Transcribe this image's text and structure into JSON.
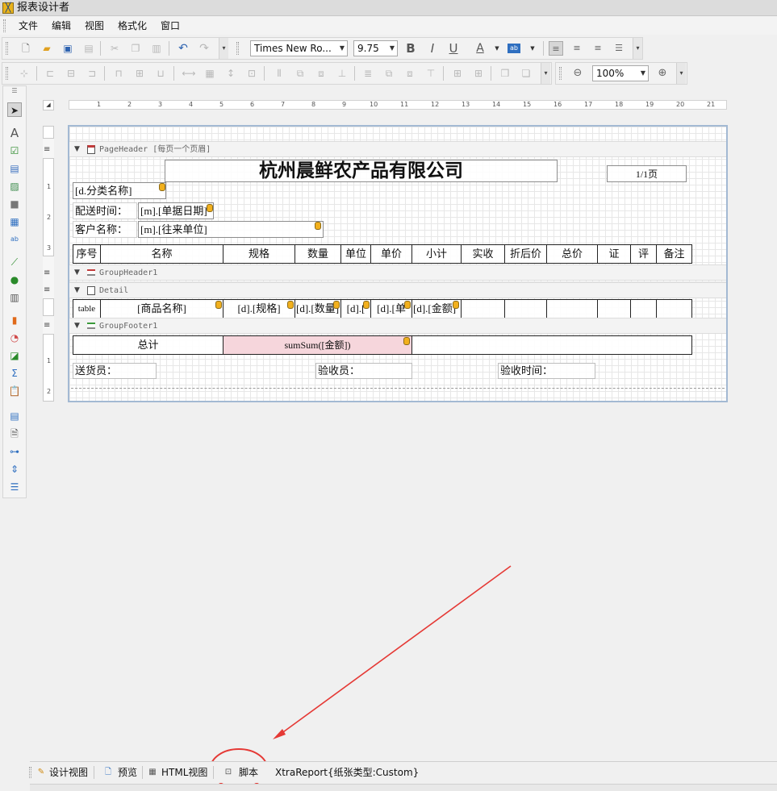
{
  "app": {
    "title": "报表设计者",
    "icon": "report-designer-icon"
  },
  "menu": [
    "文件",
    "编辑",
    "视图",
    "格式化",
    "窗口"
  ],
  "toolbar1": {
    "font_family": "Times New Ro...",
    "font_size": "9.75",
    "bold": "B",
    "italic": "I",
    "underline": "U",
    "font_color": "A",
    "highlight": "ab"
  },
  "toolbar2": {
    "zoom": "100%"
  },
  "ruler": [
    "1",
    "2",
    "3",
    "4",
    "5",
    "6",
    "7",
    "8",
    "9",
    "10",
    "11",
    "12",
    "13",
    "14",
    "15",
    "16",
    "17",
    "18",
    "19",
    "20",
    "21"
  ],
  "vruler": {
    "seg1": [
      "1",
      "2",
      "3"
    ],
    "seg2": [
      "1",
      "2"
    ]
  },
  "bands": {
    "page_header": "PageHeader [每页一个页眉]",
    "group_header": "GroupHeader1",
    "detail": "Detail",
    "group_footer": "GroupFooter1"
  },
  "report": {
    "title": "杭州晨鲜农产品有限公司",
    "page_no": "1/1页",
    "category": "[d.分类名称]",
    "delivery_label": "配送时间：",
    "delivery_value": "[m].[单据日期]",
    "customer_label": "客户名称：",
    "customer_value": "[m].[往来单位]"
  },
  "table_header": [
    "序号",
    "名称",
    "规格",
    "数量",
    "单位",
    "单价",
    "小计",
    "实收",
    "折后价",
    "总价",
    "证",
    "评",
    "备注"
  ],
  "detail_row": [
    "table",
    "[商品名称]",
    "[d].[规格]",
    "[d].[数量]",
    "[d].[",
    "[d].[单",
    "[d].[金额]",
    "",
    "",
    "",
    "",
    "",
    ""
  ],
  "footer": {
    "total_label": "总计",
    "total_value": "sumSum([金额])",
    "sender": "送货员：",
    "inspector": "验收员：",
    "inspect_time": "验收时间："
  },
  "bottom_tabs": {
    "design": "设计视图",
    "preview": "预览",
    "html": "HTML视图",
    "script": "脚本",
    "status": "XtraReport{纸张类型:Custom}"
  },
  "colors": {
    "annotation_red": "#e53935",
    "selected_cell": "#f6d6dc",
    "canvas_border": "#a3b9d3"
  }
}
